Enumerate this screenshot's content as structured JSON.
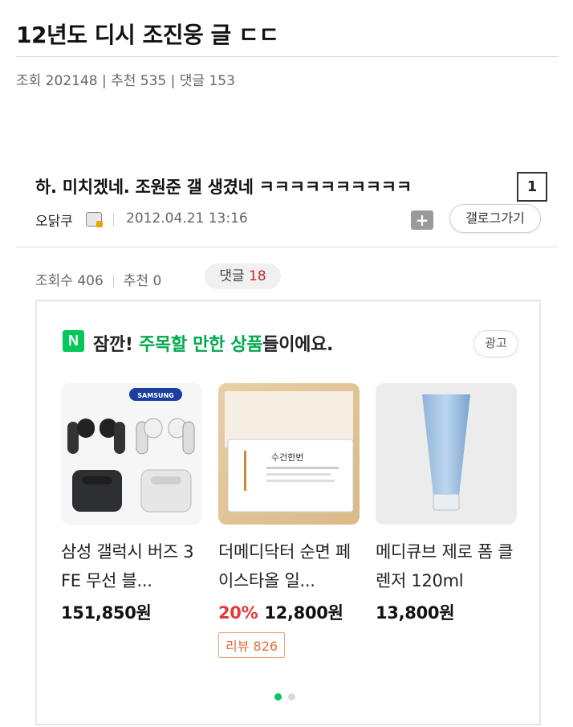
{
  "post": {
    "title": "12년도 디시 조진웅 글 ㄷㄷ",
    "meta": "조회 202148 | 추천 535 | 댓글 153"
  },
  "dc": {
    "title": "하. 미치겠네. 조원준 갤 생겼네 ㅋㅋㅋㅋㅋㅋㅋㅋㅋㅋ",
    "page_number": "1",
    "author": "오닭쿠",
    "date": "2012.04.21 13:16",
    "add_icon": "+",
    "gallery_button": "갤로그가기",
    "views": "조회수 406",
    "recommend": "추천 0",
    "comments_label": "댓글",
    "comments_count": "18"
  },
  "ad": {
    "logo_letter": "N",
    "headline_part1": "잠깐! ",
    "headline_green": "주목할 만한 상품",
    "headline_part2": "들이에요.",
    "badge": "광고",
    "products": [
      {
        "name": "삼성 갤럭시 버즈 3 FE 무선 블...",
        "discount": "",
        "price": "151,850원",
        "review": "",
        "brand_text": "SAMSUNG"
      },
      {
        "name": "더메디닥터 순면 페이스타올 일...",
        "discount": "20%",
        "price": "12,800원",
        "review": "리뷰 826",
        "brand_text": "수건한번"
      },
      {
        "name": "메디큐브 제로 폼 클렌저 120ml",
        "discount": "",
        "price": "13,800원",
        "review": "",
        "brand_text": ""
      }
    ]
  },
  "colors": {
    "naver_green": "#03c75a",
    "discount_red": "#e53935",
    "comment_count_red": "#c62828",
    "review_orange": "#e0703a"
  },
  "icons": [
    "user-badge-icon",
    "add-icon",
    "naver-logo-icon"
  ]
}
